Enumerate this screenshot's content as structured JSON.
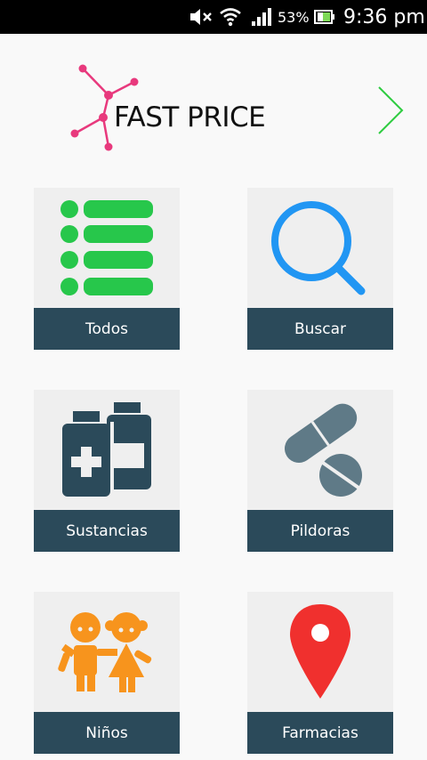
{
  "status_bar": {
    "battery_percent": "53%",
    "time": "9:36 pm",
    "icons": [
      "mute-icon",
      "wifi-icon",
      "signal-icon",
      "battery-icon"
    ]
  },
  "header": {
    "logo_text": "FAST PRICE",
    "logo_colors": {
      "nodes": "#e8397d",
      "text": "#111111"
    },
    "next_icon": "chevron-right-icon",
    "next_color": "#2ecc40"
  },
  "menu": {
    "items": [
      {
        "label": "Todos",
        "icon": "list-icon"
      },
      {
        "label": "Buscar",
        "icon": "search-icon"
      },
      {
        "label": "Sustancias",
        "icon": "medicine-bottles-icon"
      },
      {
        "label": "Pildoras",
        "icon": "pills-icon"
      },
      {
        "label": "Niños",
        "icon": "children-icon"
      },
      {
        "label": "Farmacias",
        "icon": "map-pin-icon"
      }
    ],
    "label_bg": "#2b4a5a",
    "tile_bg": "#efefef"
  }
}
